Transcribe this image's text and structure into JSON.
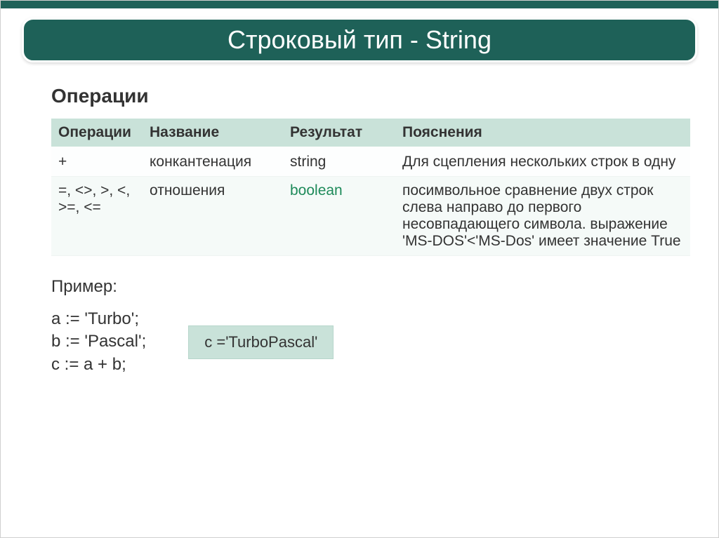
{
  "slide": {
    "title": "Строковый тип - String",
    "section_heading": "Операции"
  },
  "table": {
    "headers": {
      "op": "Операции",
      "name": "Название",
      "result": "Результат",
      "desc": "Пояснения"
    },
    "rows": [
      {
        "op": "+",
        "name": "конкантенация",
        "result": "string",
        "result_green": false,
        "desc": "Для сцепления нескольких строк в одну"
      },
      {
        "op": "=, <>, >, <, >=, <=",
        "name": "отношения",
        "result": "boolean",
        "result_green": true,
        "desc": "посимвольное сравнение двух строк слева направо до первого несовпадающего символа. выражение 'MS-DOS'<'MS-Dos' имеет значение True"
      }
    ]
  },
  "example": {
    "label": "Пример:",
    "line1": "a := 'Turbo';",
    "line2": "b := 'Pascal';",
    "line3": "c := a + b;",
    "result": "c ='TurboPascal'"
  }
}
